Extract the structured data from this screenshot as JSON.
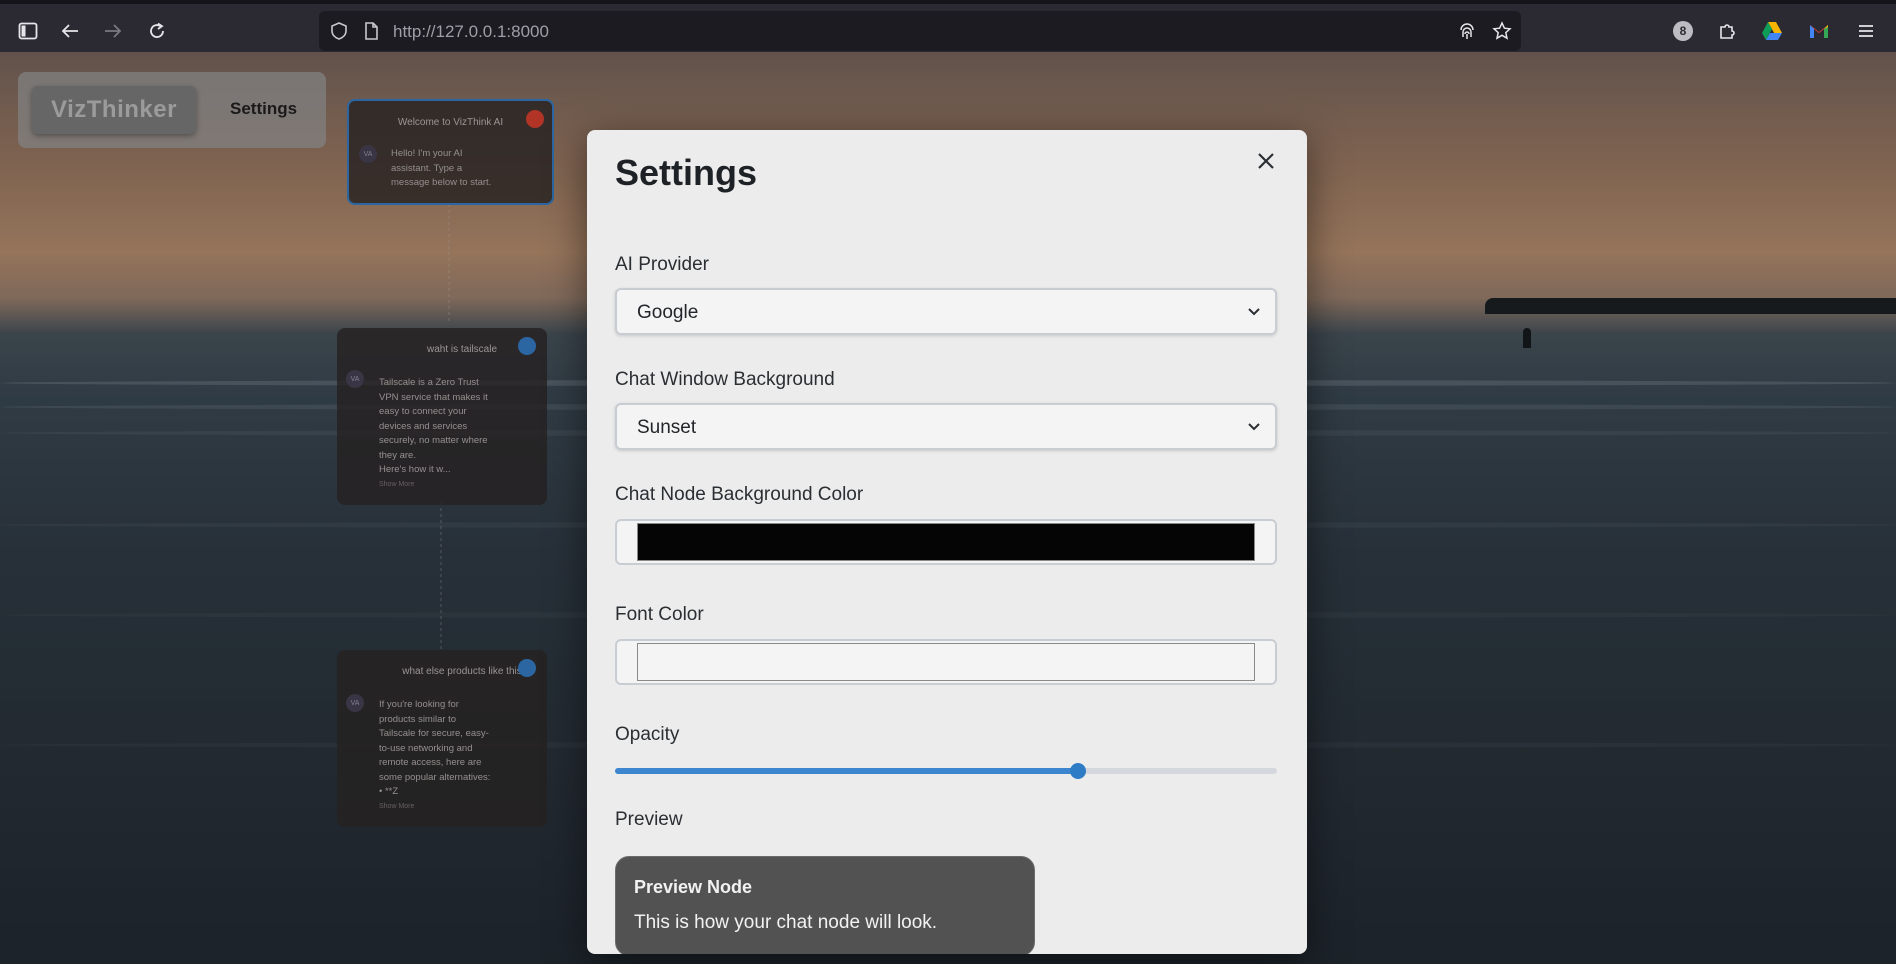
{
  "browser": {
    "url": "http://127.0.0.1:8000",
    "extension_badge": "8"
  },
  "app": {
    "brand": "VizThinker",
    "settings_link": "Settings"
  },
  "nodes": [
    {
      "title": "Welcome to VizThink AI",
      "avatar": "VA",
      "body_lines": [
        "Hello! I'm your AI",
        "assistant. Type a",
        "message below to start."
      ],
      "badge_color": "#c0392b"
    },
    {
      "title": "waht is tailscale",
      "avatar": "VA",
      "body_lines": [
        "Tailscale is a Zero Trust",
        "VPN service that makes it",
        "easy to connect your",
        "devices and services",
        "securely, no matter where",
        "they are.",
        "Here's how it w..."
      ],
      "more": "Show More",
      "badge_color": "#2f6fb0"
    },
    {
      "title": "what else products like this",
      "avatar": "VA",
      "body_lines": [
        "If you're looking for",
        "products similar to",
        "Tailscale for secure, easy-",
        "to-use networking and",
        "remote access, here are",
        "some popular alternatives:",
        "• **Z"
      ],
      "more": "Show More",
      "badge_color": "#2f6fb0"
    }
  ],
  "modal": {
    "title": "Settings",
    "ai_provider": {
      "label": "AI Provider",
      "value": "Google"
    },
    "chat_bg": {
      "label": "Chat Window Background",
      "value": "Sunset"
    },
    "node_bg": {
      "label": "Chat Node Background Color",
      "value": "#050505"
    },
    "font_color": {
      "label": "Font Color",
      "value": "#f4f4f4"
    },
    "opacity": {
      "label": "Opacity",
      "value": 0.7
    },
    "preview": {
      "label": "Preview",
      "node_title": "Preview Node",
      "node_text": "This is how your chat node will look."
    }
  }
}
